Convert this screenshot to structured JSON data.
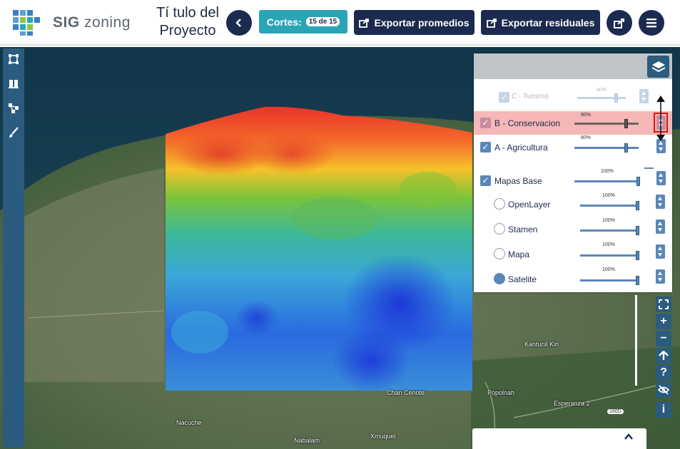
{
  "header": {
    "logo_text_bold": "SIG",
    "logo_text_rest": "zoning",
    "project_title": "Tí tulo del Proyecto",
    "cortes_label": "Cortes:",
    "cortes_badge": "15 de 15",
    "export_promedios": "Exportar promedios",
    "export_residuales": "Exportar residuales"
  },
  "layers": [
    {
      "label": "C - Turismo",
      "percent": "80%",
      "opacity_value": 0.8,
      "checked": true,
      "faded": true
    },
    {
      "label": "B - Conservacion",
      "percent": "80%",
      "opacity_value": 0.8,
      "checked": true,
      "highlighted": true
    },
    {
      "label": "A - Agricultura",
      "percent": "80%",
      "opacity_value": 0.8,
      "checked": true
    }
  ],
  "base_maps": {
    "label": "Mapas Base",
    "percent": "100%",
    "checked": true,
    "options": [
      {
        "label": "OpenLayer",
        "percent": "100%",
        "selected": false
      },
      {
        "label": "Stamen",
        "percent": "100%",
        "selected": false
      },
      {
        "label": "Mapa",
        "percent": "100%",
        "selected": false
      },
      {
        "label": "Satelite",
        "percent": "100%",
        "selected": true
      }
    ]
  },
  "map_labels": {
    "chan_cenote": "Chan Cenote",
    "popolnah": "Popolnah",
    "kantunil_kin": "Kantunil Kin",
    "esperanza": "Esperanza 2",
    "nacuche": "Nacuche",
    "xmuquel": "Xmuquel",
    "nabalam": "Nabalam",
    "road_marker": "180D"
  },
  "right_toolbar": {
    "zoom_in": "+",
    "zoom_out": "−",
    "help": "?",
    "info": "i"
  },
  "colors": {
    "navy": "#1b2a4e",
    "teal": "#2aa5b6",
    "panel_blue": "#2b5b7e",
    "highlight_row": "#f5b7b7"
  }
}
